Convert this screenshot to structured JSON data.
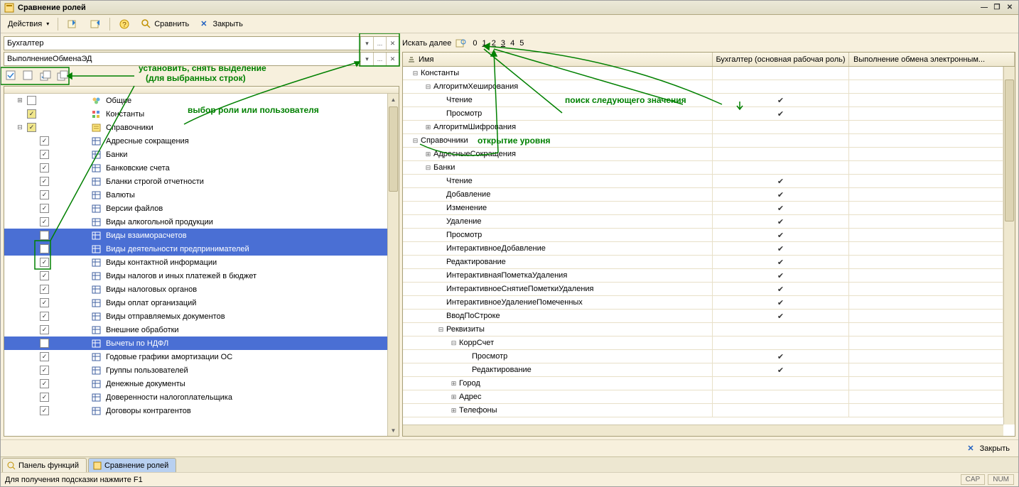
{
  "title": "Сравнение ролей",
  "toolbar": {
    "actions": "Действия",
    "compare": "Сравнить",
    "close": "Закрыть"
  },
  "role1": "Бухгалтер",
  "role2": "ВыполнениеОбменаЭД",
  "ann": {
    "set": "установить, снять выделение",
    "set2": "(для выбранных строк)",
    "choose": "выбор роли или пользователя",
    "search": "поиск следующего значения",
    "open": "открытие уровня"
  },
  "left_tree": [
    {
      "d": 0,
      "exp": "+",
      "chk": "",
      "ic": "grp",
      "t": "Общие"
    },
    {
      "d": 0,
      "exp": "",
      "chk": "g",
      "ic": "const",
      "t": "Константы"
    },
    {
      "d": 0,
      "exp": "-",
      "chk": "g",
      "ic": "ref",
      "t": "Справочники"
    },
    {
      "d": 1,
      "exp": "",
      "chk": "y",
      "ic": "tbl",
      "t": "Адресные сокращения"
    },
    {
      "d": 1,
      "exp": "",
      "chk": "y",
      "ic": "tbl",
      "t": "Банки"
    },
    {
      "d": 1,
      "exp": "",
      "chk": "y",
      "ic": "tbl",
      "t": "Банковские счета"
    },
    {
      "d": 1,
      "exp": "",
      "chk": "y",
      "ic": "tbl",
      "t": "Бланки строгой отчетности"
    },
    {
      "d": 1,
      "exp": "",
      "chk": "y",
      "ic": "tbl",
      "t": "Валюты"
    },
    {
      "d": 1,
      "exp": "",
      "chk": "y",
      "ic": "tbl",
      "t": "Версии файлов"
    },
    {
      "d": 1,
      "exp": "",
      "chk": "y",
      "ic": "tbl",
      "t": "Виды алкогольной продукции"
    },
    {
      "d": 1,
      "exp": "",
      "chk": "",
      "ic": "tbl",
      "t": "Виды взаиморасчетов",
      "sel": true
    },
    {
      "d": 1,
      "exp": "",
      "chk": "",
      "ic": "tbl",
      "t": "Виды деятельности предпринимателей",
      "sel": true
    },
    {
      "d": 1,
      "exp": "",
      "chk": "y",
      "ic": "tbl",
      "t": "Виды контактной информации"
    },
    {
      "d": 1,
      "exp": "",
      "chk": "y",
      "ic": "tbl",
      "t": "Виды налогов и иных платежей в бюджет"
    },
    {
      "d": 1,
      "exp": "",
      "chk": "y",
      "ic": "tbl",
      "t": "Виды налоговых органов"
    },
    {
      "d": 1,
      "exp": "",
      "chk": "y",
      "ic": "tbl",
      "t": "Виды оплат организаций"
    },
    {
      "d": 1,
      "exp": "",
      "chk": "y",
      "ic": "tbl",
      "t": "Виды отправляемых документов"
    },
    {
      "d": 1,
      "exp": "",
      "chk": "y",
      "ic": "tbl",
      "t": "Внешние обработки"
    },
    {
      "d": 1,
      "exp": "",
      "chk": "",
      "ic": "tbl",
      "t": "Вычеты по НДФЛ",
      "sel": true
    },
    {
      "d": 1,
      "exp": "",
      "chk": "y",
      "ic": "tbl",
      "t": "Годовые графики амортизации ОС"
    },
    {
      "d": 1,
      "exp": "",
      "chk": "y",
      "ic": "tbl",
      "t": "Группы пользователей"
    },
    {
      "d": 1,
      "exp": "",
      "chk": "y",
      "ic": "tbl",
      "t": "Денежные документы"
    },
    {
      "d": 1,
      "exp": "",
      "chk": "y",
      "ic": "tbl",
      "t": "Доверенности налогоплательщика"
    },
    {
      "d": 1,
      "exp": "",
      "chk": "y",
      "ic": "tbl",
      "t": "Договоры контрагентов"
    }
  ],
  "search": {
    "label": "Искать далее",
    "nums": [
      "0",
      "1",
      "2",
      "3",
      "4",
      "5"
    ]
  },
  "grid_head": {
    "c0": "Имя",
    "c1": "Бухгалтер (основная рабочая роль)",
    "c2": "Выполнение обмена электронным..."
  },
  "grid": [
    {
      "d": 0,
      "exp": "-",
      "t": "Константы"
    },
    {
      "d": 1,
      "exp": "-",
      "t": "АлгоритмХеширования"
    },
    {
      "d": 2,
      "exp": "",
      "t": "Чтение",
      "v1": true
    },
    {
      "d": 2,
      "exp": "",
      "t": "Просмотр",
      "v1": true
    },
    {
      "d": 1,
      "exp": "+",
      "t": "АлгоритмШифрования"
    },
    {
      "d": 0,
      "exp": "-",
      "t": "Справочники"
    },
    {
      "d": 1,
      "exp": "+",
      "t": "АдресныеСокращения"
    },
    {
      "d": 1,
      "exp": "-",
      "t": "Банки"
    },
    {
      "d": 2,
      "exp": "",
      "t": "Чтение",
      "v1": true
    },
    {
      "d": 2,
      "exp": "",
      "t": "Добавление",
      "v1": true
    },
    {
      "d": 2,
      "exp": "",
      "t": "Изменение",
      "v1": true
    },
    {
      "d": 2,
      "exp": "",
      "t": "Удаление",
      "v1": true
    },
    {
      "d": 2,
      "exp": "",
      "t": "Просмотр",
      "v1": true
    },
    {
      "d": 2,
      "exp": "",
      "t": "ИнтерактивноеДобавление",
      "v1": true
    },
    {
      "d": 2,
      "exp": "",
      "t": "Редактирование",
      "v1": true
    },
    {
      "d": 2,
      "exp": "",
      "t": "ИнтерактивнаяПометкаУдаления",
      "v1": true
    },
    {
      "d": 2,
      "exp": "",
      "t": "ИнтерактивноеСнятиеПометкиУдаления",
      "v1": true
    },
    {
      "d": 2,
      "exp": "",
      "t": "ИнтерактивноеУдалениеПомеченных",
      "v1": true
    },
    {
      "d": 2,
      "exp": "",
      "t": "ВводПоСтроке",
      "v1": true
    },
    {
      "d": 2,
      "exp": "-",
      "t": "Реквизиты"
    },
    {
      "d": 3,
      "exp": "-",
      "t": "КоррСчет"
    },
    {
      "d": 4,
      "exp": "",
      "t": "Просмотр",
      "v1": true
    },
    {
      "d": 4,
      "exp": "",
      "t": "Редактирование",
      "v1": true
    },
    {
      "d": 3,
      "exp": "+",
      "t": "Город"
    },
    {
      "d": 3,
      "exp": "+",
      "t": "Адрес"
    },
    {
      "d": 3,
      "exp": "+",
      "t": "Телефоны"
    }
  ],
  "footer_close": "Закрыть",
  "tabs": {
    "t1": "Панель функций",
    "t2": "Сравнение ролей"
  },
  "status": {
    "hint": "Для получения подсказки нажмите F1",
    "cap": "CAP",
    "num": "NUM"
  }
}
